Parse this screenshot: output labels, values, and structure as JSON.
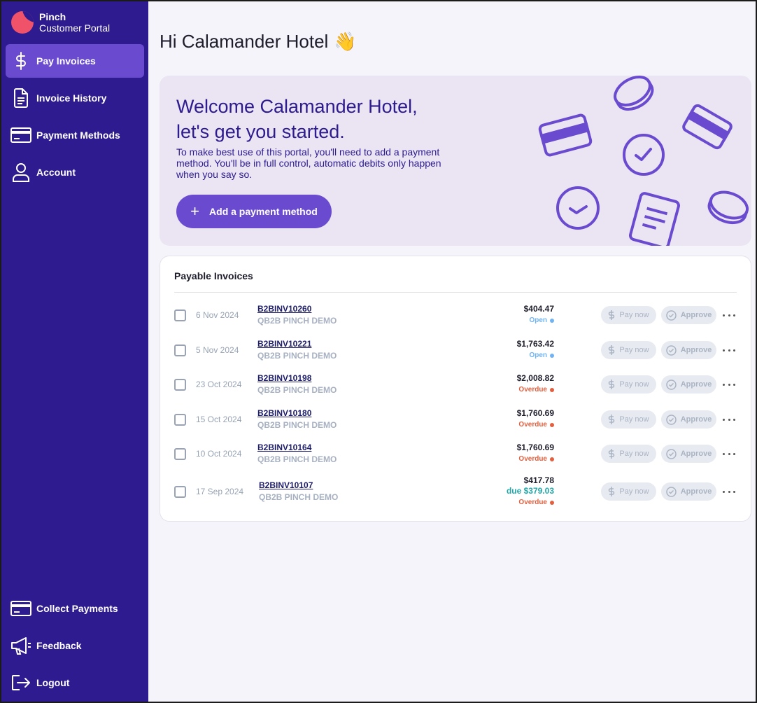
{
  "brand": {
    "name": "Pinch",
    "subtitle": "Customer Portal"
  },
  "nav": {
    "top": [
      {
        "label": "Pay Invoices",
        "icon": "dollar-icon",
        "active": true
      },
      {
        "label": "Invoice History",
        "icon": "document-icon"
      },
      {
        "label": "Payment Methods",
        "icon": "credit-card-icon"
      },
      {
        "label": "Account",
        "icon": "user-icon"
      }
    ],
    "bottom": [
      {
        "label": "Collect Payments",
        "icon": "credit-card-icon"
      },
      {
        "label": "Feedback",
        "icon": "megaphone-icon"
      },
      {
        "label": "Logout",
        "icon": "logout-icon"
      }
    ]
  },
  "greeting": {
    "text": "Hi Calamander Hotel",
    "emoji": "👋"
  },
  "welcome": {
    "title_line1": "Welcome Calamander Hotel,",
    "title_line2": "let's get you started.",
    "body": "To make best use of this portal, you'll need to add a payment method. You'll be in full control, automatic debits only happen when you say so.",
    "button": "Add a payment method"
  },
  "invoices": {
    "title": "Payable Invoices",
    "pay_label": "Pay now",
    "approve_label": "Approve",
    "rows": [
      {
        "date": "6 Nov 2024",
        "number": "B2BINV10260",
        "company": "QB2B PINCH DEMO",
        "amount": "$404.47",
        "due": "",
        "status": "Open"
      },
      {
        "date": "5 Nov 2024",
        "number": "B2BINV10221",
        "company": "QB2B PINCH DEMO",
        "amount": "$1,763.42",
        "due": "",
        "status": "Open"
      },
      {
        "date": "23 Oct 2024",
        "number": "B2BINV10198",
        "company": "QB2B PINCH DEMO",
        "amount": "$2,008.82",
        "due": "",
        "status": "Overdue"
      },
      {
        "date": "15 Oct 2024",
        "number": "B2BINV10180",
        "company": "QB2B PINCH DEMO",
        "amount": "$1,760.69",
        "due": "",
        "status": "Overdue"
      },
      {
        "date": "10 Oct 2024",
        "number": "B2BINV10164",
        "company": "QB2B PINCH DEMO",
        "amount": "$1,760.69",
        "due": "",
        "status": "Overdue"
      },
      {
        "date": "17 Sep 2024",
        "number": "B2BINV10107",
        "company": "QB2B PINCH DEMO",
        "amount": "$417.78",
        "due": "due $379.03",
        "status": "Overdue"
      }
    ]
  },
  "colors": {
    "sidebar": "#2d1b8f",
    "accent": "#6a4bd0",
    "open": "#6fb3f2",
    "overdue": "#e2603f",
    "due": "#21a8a8"
  }
}
